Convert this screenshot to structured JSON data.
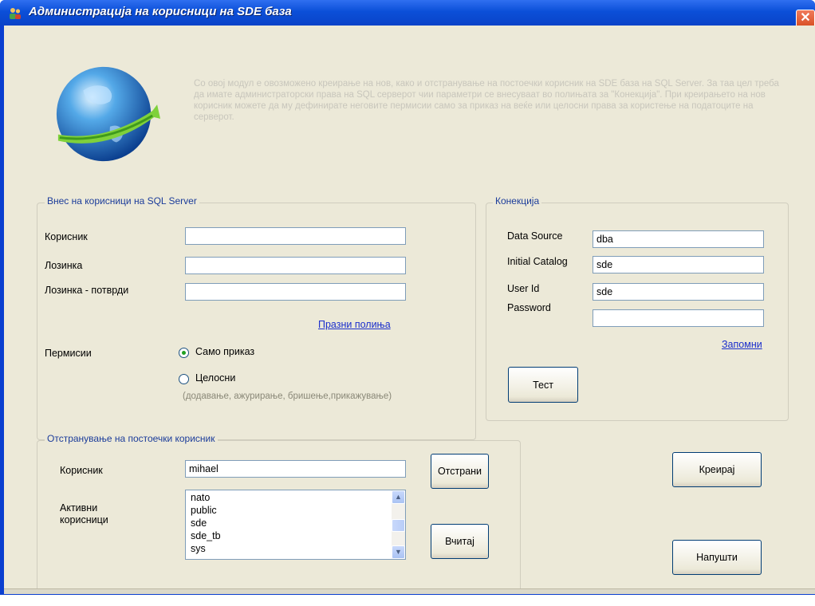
{
  "window": {
    "title": "Администрација на корисници на SDE база",
    "close_glyph": "✕"
  },
  "intro": {
    "text": "Со овој модул е овозможено креирање на нов, како и отстранување на постоечки корисник на SDE база на SQL Server. За таа цел треба да имате администраторски права на SQL серверот чии параметри се внесуваат во полињата за \"Конекција\". При креирањето на нов корисник можете да му дефинирате неговите пермисии само за приказ на веќе или целосни права за користење на податоците на серверот."
  },
  "sql_users": {
    "legend": "Внес на корисници на SQL Server",
    "user_label": "Корисник",
    "user_value": "",
    "password_label": "Лозинка",
    "password_value": "",
    "confirm_label": "Лозинка - потврди",
    "confirm_value": "",
    "clear_link": "Празни полиња",
    "permissions_label": "Пермисии",
    "option_view": "Само приказ",
    "option_full": "Целосни",
    "option_full_hint": "(додавање, ажурирање, бришење,прикажување)",
    "selected_option": "view"
  },
  "connection": {
    "legend": "Конекција",
    "data_source_label": "Data Source",
    "data_source_value": "dba",
    "catalog_label": "Initial Catalog",
    "catalog_value": "sde",
    "user_id_label": "User Id",
    "user_id_value": "sde",
    "password_label": "Password",
    "password_value": "",
    "remember_link": "Запомни",
    "test_button": "Тест"
  },
  "remove_user": {
    "legend": "Отстранување на постоечки корисник",
    "user_label": "Корисник",
    "user_value": "mihael",
    "remove_button": "Отстрани",
    "active_users_label_line1": "Активни",
    "active_users_label_line2": "корисници",
    "active_users": [
      "nato",
      "public",
      "sde",
      "sde_tb",
      "sys"
    ],
    "load_button": "Вчитај"
  },
  "actions": {
    "create_button": "Креирај",
    "exit_button": "Напушти"
  },
  "icons": {
    "title": "users-icon",
    "globe": "globe-icon"
  }
}
